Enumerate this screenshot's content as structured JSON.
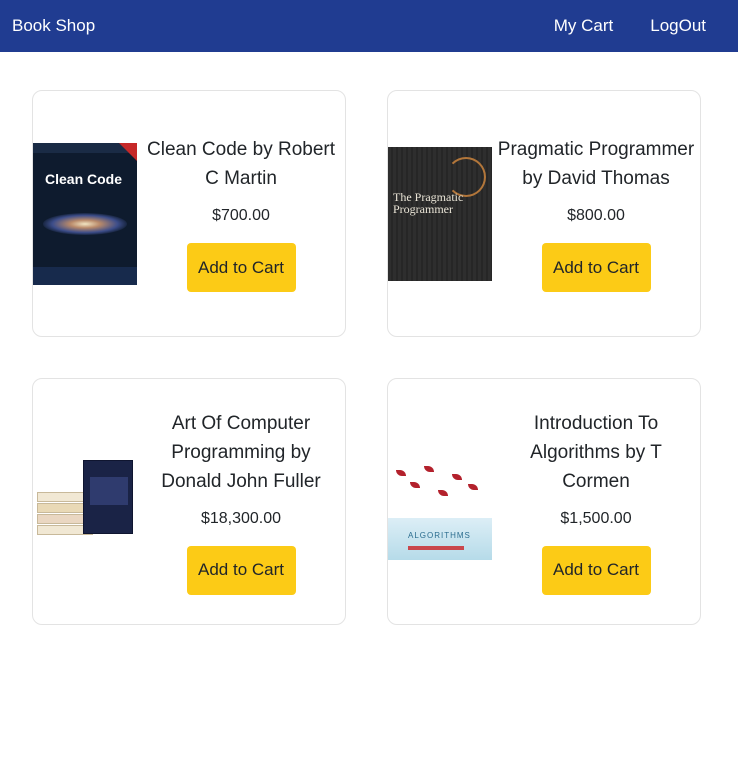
{
  "navbar": {
    "brand": "Book Shop",
    "links": [
      "My Cart",
      "LogOut"
    ],
    "background": "#203c91"
  },
  "products": [
    {
      "title": "Clean Code by Robert C Martin",
      "price": "$700.00",
      "button": "Add to Cart",
      "cover_text": "Clean Code"
    },
    {
      "title": "Pragmatic Programmer by David Thomas",
      "price": "$800.00",
      "button": "Add to Cart",
      "cover_text": "The Pragmatic Programmer"
    },
    {
      "title": "Art Of Computer Programming by Donald John Fuller",
      "price": "$18,300.00",
      "button": "Add to Cart"
    },
    {
      "title": "Introduction To Algorithms by T Cormen",
      "price": "$1,500.00",
      "button": "Add to Cart",
      "cover_text": "ALGORITHMS"
    }
  ],
  "colors": {
    "button": "#fccb16",
    "card_border": "#e3e3e3"
  }
}
